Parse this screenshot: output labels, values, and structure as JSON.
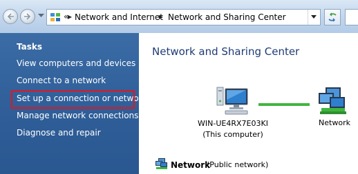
{
  "window": {
    "breadcrumbs": [
      "Network and Internet",
      "Network and Sharing Center"
    ],
    "overflow_chevron": "«"
  },
  "sidebar": {
    "title": "Tasks",
    "items": [
      {
        "label": "View computers and devices"
      },
      {
        "label": "Connect to a network"
      },
      {
        "label": "Set up a connection or network",
        "highlighted": true
      },
      {
        "label": "Manage network connections"
      },
      {
        "label": "Diagnose and repair"
      }
    ]
  },
  "main": {
    "title": "Network and Sharing Center",
    "map": {
      "computer_name": "WIN-UE4RX7E03KI",
      "computer_caption": "(This computer)",
      "network_label": "Network"
    },
    "network_section": {
      "name": "Network",
      "type": "(Public network)"
    }
  },
  "icons": {
    "back": "back-arrow-icon",
    "forward": "forward-arrow-icon",
    "address": "control-panel-icon",
    "refresh": "refresh-icon",
    "computer": "computer-icon",
    "network": "network-icon"
  },
  "colors": {
    "sidebar_bg": "#2f5e98",
    "highlight_border": "#e8141c",
    "title_text": "#1e3b73",
    "link_line": "#3fb63f"
  }
}
